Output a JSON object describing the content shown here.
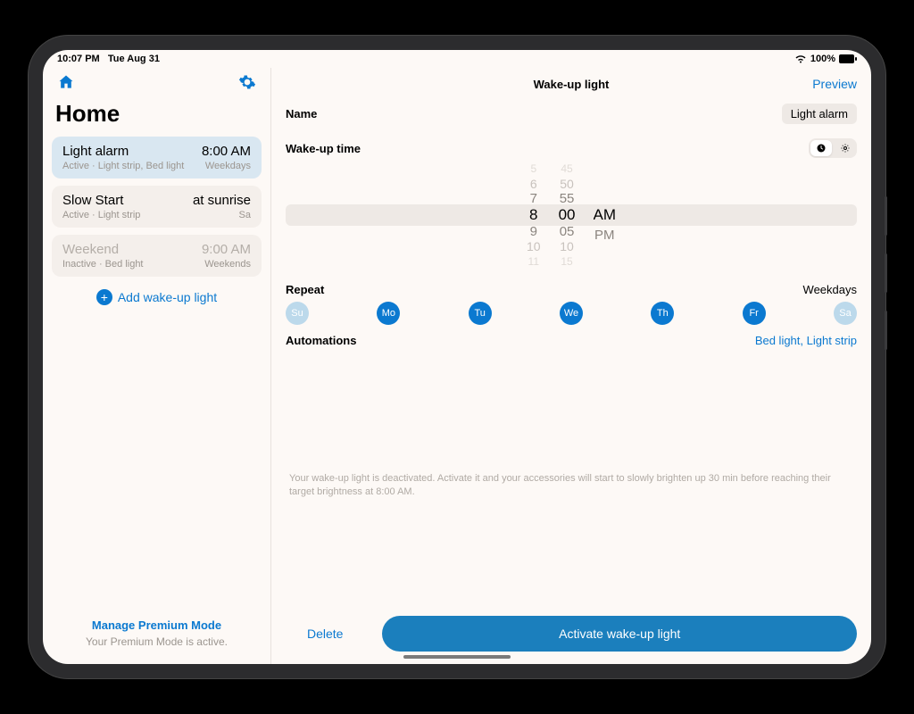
{
  "statusbar": {
    "time": "10:07 PM",
    "date": "Tue Aug 31",
    "battery": "100%"
  },
  "sidebar": {
    "title": "Home",
    "alarms": [
      {
        "name": "Light alarm",
        "time": "8:00 AM",
        "sub_left": "Active · Light strip, Bed light",
        "sub_right": "Weekdays",
        "selected": true,
        "inactive": false
      },
      {
        "name": "Slow Start",
        "time": "at sunrise",
        "sub_left": "Active · Light strip",
        "sub_right": "Sa",
        "selected": false,
        "inactive": false
      },
      {
        "name": "Weekend",
        "time": "9:00 AM",
        "sub_left": "Inactive · Bed light",
        "sub_right": "Weekends",
        "selected": false,
        "inactive": true
      }
    ],
    "add_label": "Add wake-up light",
    "premium_link": "Manage Premium Mode",
    "premium_sub": "Your Premium Mode is active."
  },
  "main": {
    "title": "Wake-up light",
    "preview": "Preview",
    "name_label": "Name",
    "name_value": "Light alarm",
    "wake_label": "Wake-up time",
    "picker": {
      "hours": [
        "5",
        "6",
        "7",
        "8",
        "9",
        "10",
        "11"
      ],
      "minutes": [
        "45",
        "50",
        "55",
        "00",
        "05",
        "10",
        "15"
      ],
      "ampm": [
        "AM",
        "PM"
      ]
    },
    "repeat_label": "Repeat",
    "repeat_summary": "Weekdays",
    "days": [
      {
        "label": "Su",
        "on": false
      },
      {
        "label": "Mo",
        "on": true
      },
      {
        "label": "Tu",
        "on": true
      },
      {
        "label": "We",
        "on": true
      },
      {
        "label": "Th",
        "on": true
      },
      {
        "label": "Fr",
        "on": true
      },
      {
        "label": "Sa",
        "on": false
      }
    ],
    "automations_label": "Automations",
    "automations_value": "Bed light, Light strip",
    "info": "Your wake-up light is deactivated. Activate it and your accessories will start to slowly brighten up 30 min before reaching their target brightness at 8:00 AM.",
    "delete": "Delete",
    "activate": "Activate wake-up light"
  }
}
